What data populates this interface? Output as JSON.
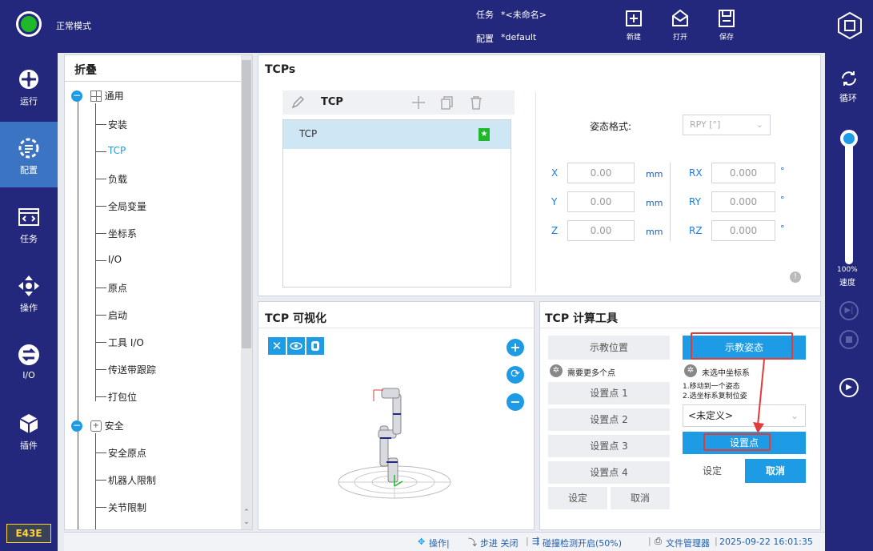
{
  "header": {
    "mode": "正常模式",
    "task_label": "任务",
    "task_value": "*<未命名>",
    "config_label": "配置",
    "config_value": "*default",
    "new_label": "新建",
    "open_label": "打开",
    "save_label": "保存"
  },
  "leftnav": {
    "items": [
      {
        "label": "运行"
      },
      {
        "label": "配置"
      },
      {
        "label": "任务"
      },
      {
        "label": "操作"
      },
      {
        "label": "I/O"
      },
      {
        "label": "插件"
      }
    ],
    "badge": "E43E"
  },
  "tree": {
    "title": "折叠",
    "general": "通用",
    "items": [
      "安装",
      "TCP",
      "负载",
      "全局变量",
      "坐标系",
      "I/O",
      "原点",
      "启动",
      "工具 I/O",
      "传送带跟踪",
      "打包位"
    ],
    "safety": "安全",
    "safety_items": [
      "安全原点",
      "机器人限制",
      "关节限制"
    ]
  },
  "tcps": {
    "title": "TCPs",
    "toolbar_label": "TCP",
    "list": [
      "TCP"
    ],
    "pose_format_label": "姿态格式:",
    "pose_format_value": "RPY [°]",
    "fields": [
      {
        "axis": "X",
        "value": "0.00",
        "unit": "mm",
        "raxis": "RX",
        "rvalue": "0.000",
        "runit": "°"
      },
      {
        "axis": "Y",
        "value": "0.00",
        "unit": "mm",
        "raxis": "RY",
        "rvalue": "0.000",
        "runit": "°"
      },
      {
        "axis": "Z",
        "value": "0.00",
        "unit": "mm",
        "raxis": "RZ",
        "rvalue": "0.000",
        "runit": "°"
      }
    ]
  },
  "viz": {
    "title": "TCP 可视化"
  },
  "calc": {
    "title": "TCP 计算工具",
    "teach_pos": "示教位置",
    "teach_pose": "示教姿态",
    "need_more": "需要更多个点",
    "no_frame": "未选中坐标系",
    "hint1": "1.移动到一个姿态",
    "hint2": "2.选坐标系复制位姿",
    "points": [
      "设置点 1",
      "设置点 2",
      "设置点 3",
      "设置点 4"
    ],
    "set": "设定",
    "cancel": "取消",
    "select_value": "<未定义>",
    "set_point": "设置点",
    "set2": "设定",
    "cancel2": "取消"
  },
  "rightbar": {
    "loop": "循环",
    "speed_pct": "100%",
    "speed_label": "速度",
    "speed_level": 1.0
  },
  "status": {
    "op": "操作|",
    "step": "步进 关闭",
    "collision": "碰撞检测开启(50%)",
    "filemgr": "文件管理器",
    "datetime": "2025-09-22 16:01:35"
  },
  "colors": {
    "nav_bg": "#23287c",
    "accent": "#1d9be5",
    "highlight": "#e23b3b",
    "selected": "#cfe6f5"
  }
}
